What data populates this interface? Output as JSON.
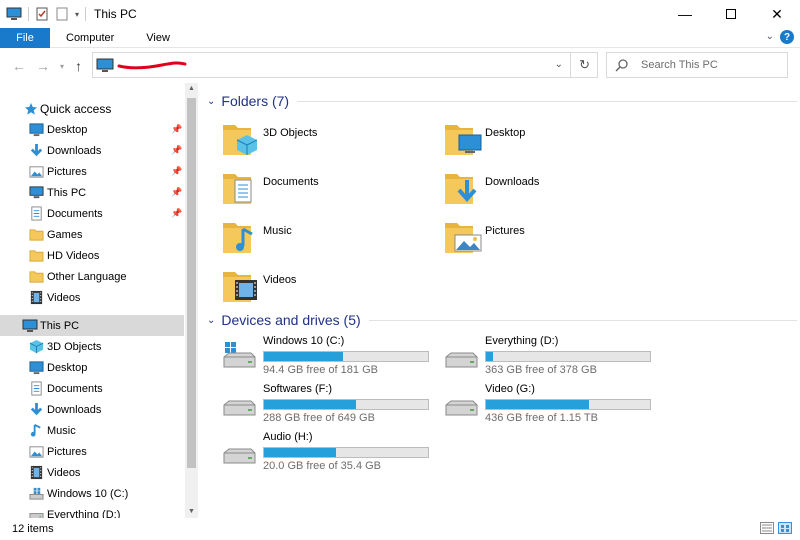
{
  "window": {
    "title": "This PC"
  },
  "ribbon": {
    "file": "File",
    "tabs": [
      "Computer",
      "View"
    ]
  },
  "search": {
    "placeholder": "Search This PC"
  },
  "nav": {
    "quick_access": "Quick access",
    "quick_items": [
      {
        "label": "Desktop",
        "icon": "desktop-icon",
        "pinned": true
      },
      {
        "label": "Downloads",
        "icon": "downloads-icon",
        "pinned": true
      },
      {
        "label": "Pictures",
        "icon": "pictures-icon",
        "pinned": true
      },
      {
        "label": "This PC",
        "icon": "this-pc-icon",
        "pinned": true
      },
      {
        "label": "Documents",
        "icon": "documents-icon",
        "pinned": true
      },
      {
        "label": "Games",
        "icon": "folder-icon",
        "pinned": false
      },
      {
        "label": "HD Videos",
        "icon": "folder-icon",
        "pinned": false
      },
      {
        "label": "Other Language",
        "icon": "folder-icon",
        "pinned": false
      },
      {
        "label": "Videos",
        "icon": "videos-icon",
        "pinned": false
      }
    ],
    "this_pc": "This PC",
    "pc_items": [
      {
        "label": "3D Objects",
        "icon": "3d-objects-icon"
      },
      {
        "label": "Desktop",
        "icon": "desktop-icon"
      },
      {
        "label": "Documents",
        "icon": "documents-icon"
      },
      {
        "label": "Downloads",
        "icon": "downloads-icon"
      },
      {
        "label": "Music",
        "icon": "music-icon"
      },
      {
        "label": "Pictures",
        "icon": "pictures-icon"
      },
      {
        "label": "Videos",
        "icon": "videos-icon"
      },
      {
        "label": "Windows 10 (C:)",
        "icon": "windows-drive-icon"
      },
      {
        "label": "Everything (D:)",
        "icon": "drive-icon"
      }
    ]
  },
  "folders": {
    "heading": "Folders (7)",
    "items": [
      {
        "label": "3D Objects",
        "icon": "3d-objects-icon"
      },
      {
        "label": "Desktop",
        "icon": "desktop-icon"
      },
      {
        "label": "Documents",
        "icon": "documents-icon"
      },
      {
        "label": "Downloads",
        "icon": "downloads-icon"
      },
      {
        "label": "Music",
        "icon": "music-icon"
      },
      {
        "label": "Pictures",
        "icon": "pictures-icon"
      },
      {
        "label": "Videos",
        "icon": "videos-icon"
      }
    ]
  },
  "drives": {
    "heading": "Devices and drives (5)",
    "items": [
      {
        "name": "Windows 10 (C:)",
        "free_text": "94.4 GB free of 181 GB",
        "used_fraction": 0.48,
        "icon": "windows-drive-icon"
      },
      {
        "name": "Everything (D:)",
        "free_text": "363 GB free of 378 GB",
        "used_fraction": 0.04,
        "icon": "drive-icon"
      },
      {
        "name": "Softwares (F:)",
        "free_text": "288 GB free of 649 GB",
        "used_fraction": 0.56,
        "icon": "drive-icon"
      },
      {
        "name": "Video (G:)",
        "free_text": "436 GB free of 1.15 TB",
        "used_fraction": 0.63,
        "icon": "drive-icon"
      },
      {
        "name": "Audio (H:)",
        "free_text": "20.0 GB free of 35.4 GB",
        "used_fraction": 0.44,
        "icon": "drive-icon"
      }
    ]
  },
  "status": {
    "count": "12 items"
  },
  "colors": {
    "accent": "#1979ca",
    "bar_fill": "#26a0da",
    "folder": "#f5c85b",
    "selected": "#d9d9d9"
  }
}
